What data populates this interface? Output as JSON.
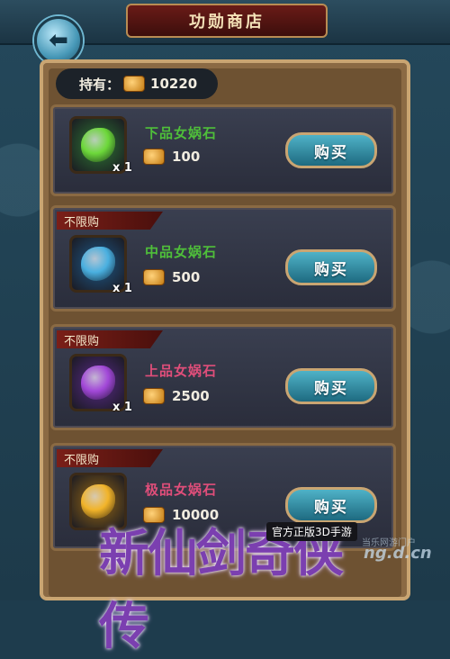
{
  "header": {
    "title": "功勋商店"
  },
  "holdings": {
    "label": "持有：",
    "amount": "10220"
  },
  "items": [
    {
      "tag": "",
      "name": "下品女娲石",
      "name_color": "#4fbf3a",
      "stone_color": "#6dd83a",
      "frame_color": "#2f7a34",
      "qty": "x 1",
      "price": "100",
      "buy_label": "购买"
    },
    {
      "tag": "不限购",
      "name": "中品女娲石",
      "name_color": "#4fbf3a",
      "stone_color": "#4ab0e0",
      "frame_color": "#1f5a8a",
      "qty": "x 1",
      "price": "500",
      "buy_label": "购买"
    },
    {
      "tag": "不限购",
      "name": "上品女娲石",
      "name_color": "#e04e7a",
      "stone_color": "#a248d8",
      "frame_color": "#5a2a8a",
      "qty": "x 1",
      "price": "2500",
      "buy_label": "购买"
    },
    {
      "tag": "不限购",
      "name": "极品女娲石",
      "name_color": "#e04e7a",
      "stone_color": "#f2b42a",
      "frame_color": "#9a6a14",
      "qty": "",
      "price": "10000",
      "buy_label": "购买"
    }
  ],
  "logo": {
    "main": "新仙剑奇侠传",
    "sub": "官方正版3D手游"
  },
  "watermark": {
    "small": "当乐网游门户",
    "main": "ng.d.cn"
  }
}
